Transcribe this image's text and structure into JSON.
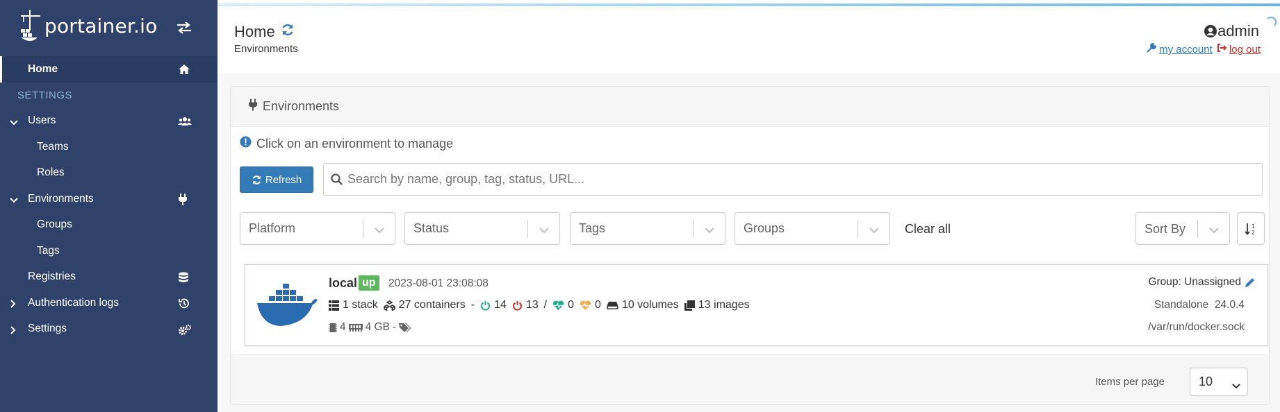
{
  "sidebar": {
    "brand": "portainer.io",
    "items": [
      {
        "label": "Home",
        "icon": "home-icon"
      },
      {
        "label": "SETTINGS"
      },
      {
        "label": "Users",
        "icon": "users-icon"
      },
      {
        "label": "Teams"
      },
      {
        "label": "Roles"
      },
      {
        "label": "Environments",
        "icon": "plug-icon"
      },
      {
        "label": "Groups"
      },
      {
        "label": "Tags"
      },
      {
        "label": "Registries",
        "icon": "database-icon"
      },
      {
        "label": "Authentication logs",
        "icon": "history-icon"
      },
      {
        "label": "Settings",
        "icon": "cogs-icon"
      }
    ]
  },
  "header": {
    "title": "Home",
    "breadcrumb": "Environments",
    "user": "admin",
    "my_account": "my account",
    "log_out": "log out"
  },
  "widget": {
    "title": "Environments",
    "info": "Click on an environment to manage",
    "refresh_label": "Refresh",
    "search_placeholder": "Search by name, group, tag, status, URL...",
    "filters": [
      "Platform",
      "Status",
      "Tags",
      "Groups"
    ],
    "clear_all": "Clear all",
    "sort_by": "Sort By",
    "items_per_page_label": "Items per page",
    "items_per_page_value": "10"
  },
  "environment": {
    "name": "local",
    "status": "up",
    "timestamp": "2023-08-01 23:08:08",
    "stacks": "1 stack",
    "containers": "27 containers",
    "dash": "-",
    "running": "14",
    "stopped": "13",
    "slash": "/",
    "healthy": "0",
    "unhealthy": "0",
    "volumes": "10 volumes",
    "images": "13 images",
    "cpu": "4",
    "memory": "4 GB",
    "res_dash": "-",
    "group": "Group: Unassigned",
    "type": "Standalone",
    "version": "24.0.4",
    "url": "/var/run/docker.sock"
  },
  "colors": {
    "sidebar_bg": "#30426a",
    "primary": "#337ab7",
    "success": "#5cb85c",
    "danger": "#c9302c"
  }
}
